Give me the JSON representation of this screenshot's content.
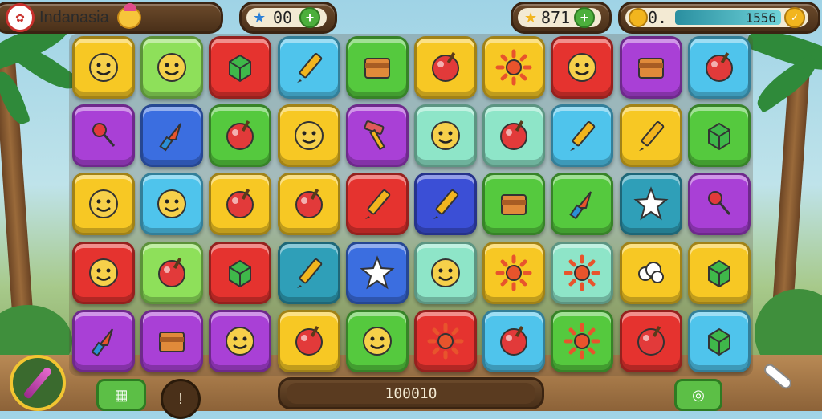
{
  "header": {
    "title": "Indanasia",
    "moves_value": "00",
    "stars_value": "871",
    "coins_value": "0.",
    "score_value": "1556"
  },
  "footer": {
    "score_display": "100010"
  },
  "board": {
    "rows": 5,
    "cols": 10,
    "tiles": [
      [
        {
          "color": "#f7c824",
          "icon": "face"
        },
        {
          "color": "#8ee05a",
          "icon": "face"
        },
        {
          "color": "#e5332f",
          "icon": "cube"
        },
        {
          "color": "#4fc4ec",
          "icon": "pencil"
        },
        {
          "color": "#55c93e",
          "icon": "box"
        },
        {
          "color": "#f7c824",
          "icon": "ball"
        },
        {
          "color": "#f7c824",
          "icon": "sun"
        },
        {
          "color": "#e5332f",
          "icon": "face"
        },
        {
          "color": "#a940d6",
          "icon": "box"
        },
        {
          "color": "#4fc4ec",
          "icon": "ball"
        }
      ],
      [
        {
          "color": "#a940d6",
          "icon": "lollipop"
        },
        {
          "color": "#3b6ee0",
          "icon": "rocket"
        },
        {
          "color": "#55c93e",
          "icon": "ball"
        },
        {
          "color": "#f7c824",
          "icon": "face"
        },
        {
          "color": "#a940d6",
          "icon": "hammer"
        },
        {
          "color": "#8ee5c8",
          "icon": "face"
        },
        {
          "color": "#8ee5c8",
          "icon": "ball"
        },
        {
          "color": "#4fc4ec",
          "icon": "pencil"
        },
        {
          "color": "#f7c824",
          "icon": "pencil"
        },
        {
          "color": "#55c93e",
          "icon": "cube"
        }
      ],
      [
        {
          "color": "#f7c824",
          "icon": "face"
        },
        {
          "color": "#4fc4ec",
          "icon": "face"
        },
        {
          "color": "#f7c824",
          "icon": "ball"
        },
        {
          "color": "#f7c824",
          "icon": "ball"
        },
        {
          "color": "#e5332f",
          "icon": "pencil"
        },
        {
          "color": "#3b4fd6",
          "icon": "pencil"
        },
        {
          "color": "#55c93e",
          "icon": "box"
        },
        {
          "color": "#55c93e",
          "icon": "rocket"
        },
        {
          "color": "#2f9fb8",
          "icon": "star"
        },
        {
          "color": "#a940d6",
          "icon": "lollipop"
        }
      ],
      [
        {
          "color": "#e5332f",
          "icon": "face"
        },
        {
          "color": "#8ee05a",
          "icon": "ball"
        },
        {
          "color": "#e5332f",
          "icon": "cube"
        },
        {
          "color": "#2f9fb8",
          "icon": "pencil"
        },
        {
          "color": "#3b6ee0",
          "icon": "star"
        },
        {
          "color": "#8ee5c8",
          "icon": "face"
        },
        {
          "color": "#f7c824",
          "icon": "sun"
        },
        {
          "color": "#8ee5c8",
          "icon": "sun"
        },
        {
          "color": "#f7c824",
          "icon": "cloud"
        },
        {
          "color": "#f7c824",
          "icon": "cube"
        }
      ],
      [
        {
          "color": "#a940d6",
          "icon": "rocket"
        },
        {
          "color": "#a940d6",
          "icon": "box"
        },
        {
          "color": "#a940d6",
          "icon": "face"
        },
        {
          "color": "#f7c824",
          "icon": "ball"
        },
        {
          "color": "#55c93e",
          "icon": "face"
        },
        {
          "color": "#e5332f",
          "icon": "sun"
        },
        {
          "color": "#4fc4ec",
          "icon": "ball"
        },
        {
          "color": "#55c93e",
          "icon": "sun"
        },
        {
          "color": "#e5332f",
          "icon": "ball"
        },
        {
          "color": "#4fc4ec",
          "icon": "cube"
        }
      ]
    ]
  }
}
